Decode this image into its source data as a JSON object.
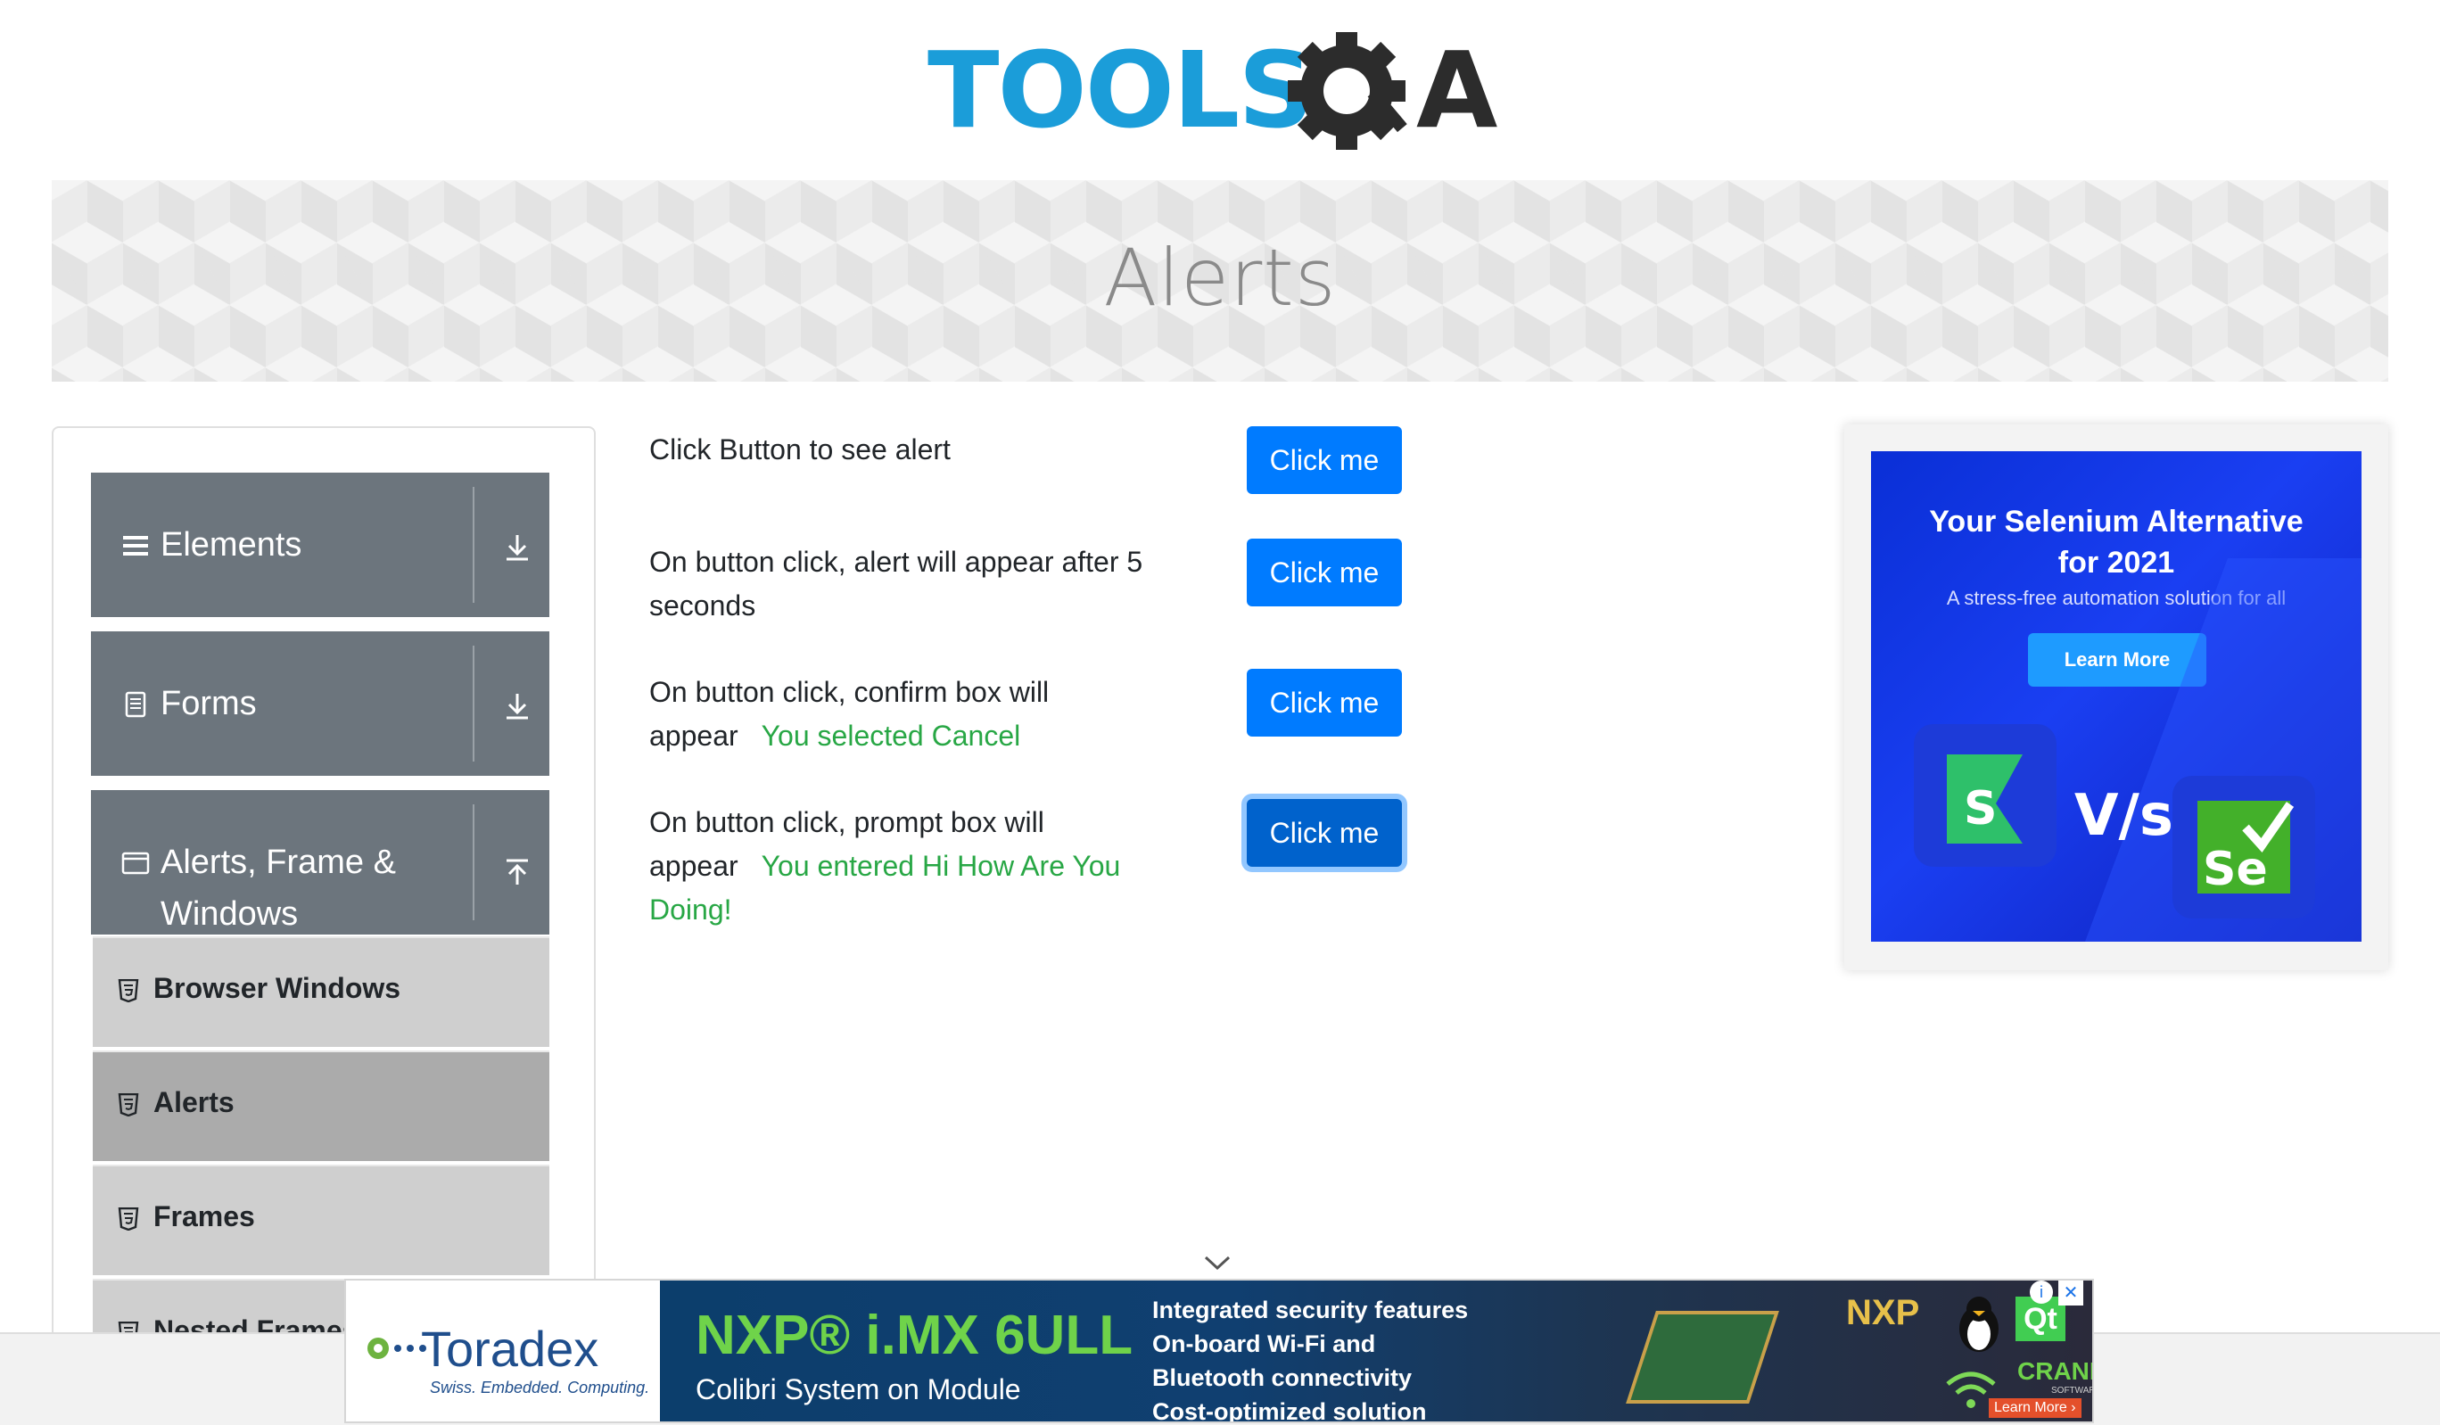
{
  "logo": {
    "text_left": "TOOLS",
    "text_right": "A"
  },
  "page": {
    "title": "Alerts"
  },
  "sidebar": {
    "groups": [
      {
        "label": "Elements",
        "icon": "menu-icon",
        "arrow": "download-arrow-icon"
      },
      {
        "label": "Forms",
        "icon": "form-icon",
        "arrow": "download-arrow-icon"
      },
      {
        "label": "Alerts, Frame &",
        "label2": "Windows",
        "icon": "window-icon",
        "arrow": "upload-arrow-icon"
      }
    ],
    "items": [
      {
        "label": "Browser Windows"
      },
      {
        "label": "Alerts"
      },
      {
        "label": "Frames"
      },
      {
        "label": "Nested Frames"
      }
    ]
  },
  "rows": [
    {
      "text": "Click Button to see alert",
      "button": "Click me"
    },
    {
      "text": "On button click, alert will appear after 5",
      "text2": "seconds",
      "button": "Click me"
    },
    {
      "text": "On button click, confirm box will",
      "text2": "appear",
      "result": "You selected Cancel",
      "button": "Click me"
    },
    {
      "text": "On button click, prompt box will",
      "text2": "appear",
      "result": "You entered Hi How Are You",
      "result2": "Doing!",
      "button": "Click me"
    }
  ],
  "ad_right": {
    "title_line1": "Your Selenium Alternative",
    "title_line2": "for 2021",
    "subtitle": "A stress-free automation solution for all",
    "cta": "Learn More",
    "vs": "V/s",
    "logo_left": "S",
    "logo_right": "Se"
  },
  "ad_bottom": {
    "brand": "Toradex",
    "brand_tagline": "Swiss. Embedded. Computing.",
    "product_line1": "NXP® i.MX 6ULL",
    "product_line2": "Colibri System on Module",
    "features": [
      "Integrated security features",
      "On-board Wi-Fi and",
      "Bluetooth connectivity",
      "Cost-optimized solution"
    ],
    "nxp": "NXP",
    "qt": "Qt",
    "crank": "CRANK",
    "crank_sub": "SOFTWARE",
    "learn_more": "Learn More ›",
    "close": "✕",
    "info": "i"
  },
  "colors": {
    "primary": "#007bff",
    "success": "#28a745",
    "sidebar_group": "#6c757d",
    "sidebar_item": "#cfcfcf",
    "sidebar_item_active": "#ababab"
  }
}
